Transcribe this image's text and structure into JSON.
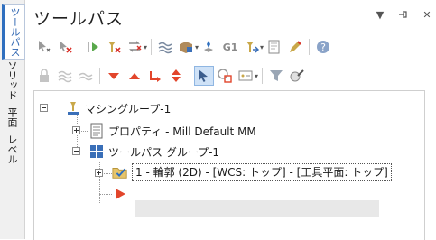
{
  "side_tabs": [
    "ツールパス",
    "ソリッド",
    "平面",
    "レベル"
  ],
  "panel": {
    "title": "ツールパス",
    "menu_icon": "dropdown-arrow",
    "pin_icon": "pin",
    "close_icon": "close"
  },
  "toolbar": {
    "row1": [
      "select-all-operations-icon",
      "select-invalid-operations-icon",
      "regenerate-selected-icon",
      "regenerate-dirty-icon",
      "toggle-display-icon",
      "simulate-toolpath-icon",
      "verify-stock-icon",
      "post-selected-icon",
      "g1-output-icon",
      "post-dirty-icon",
      "posting-icon",
      "edit-icon",
      "help-icon"
    ],
    "row2": [
      "lock-icon",
      "hide-toolpath-icon",
      "wave-icon",
      "move-down-icon",
      "move-up-icon",
      "insert-after-icon",
      "insert-arrow-icon",
      "select-cursor-icon",
      "clone-icon",
      "options-icon",
      "stock-model-icon",
      "paint-icon"
    ],
    "g1_label": "G1"
  },
  "tree": {
    "machine_group": "マシングループ-1",
    "properties": "プロパティ - Mill Default MM",
    "toolpath_group": "ツールパス グループ-1",
    "operation": "1 - 輪郭 (2D) - [WCS: トップ] - [工具平面: トップ]"
  },
  "colors": {
    "accent": "#2f6fbf",
    "arrow_red": "#d9322a",
    "insert_red": "#e2452b"
  }
}
